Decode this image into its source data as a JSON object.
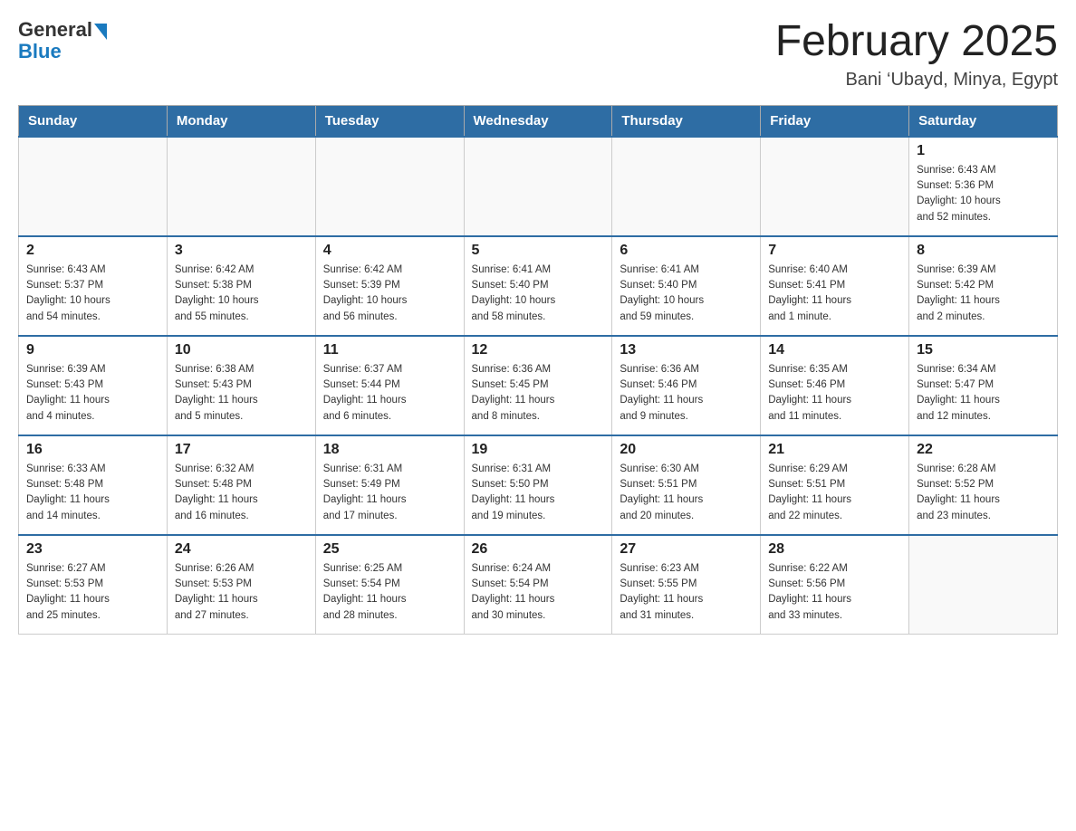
{
  "header": {
    "logo_general": "General",
    "logo_blue": "Blue",
    "month_title": "February 2025",
    "location": "Bani ‘Ubayd, Minya, Egypt"
  },
  "weekdays": [
    "Sunday",
    "Monday",
    "Tuesday",
    "Wednesday",
    "Thursday",
    "Friday",
    "Saturday"
  ],
  "weeks": [
    [
      {
        "day": "",
        "info": ""
      },
      {
        "day": "",
        "info": ""
      },
      {
        "day": "",
        "info": ""
      },
      {
        "day": "",
        "info": ""
      },
      {
        "day": "",
        "info": ""
      },
      {
        "day": "",
        "info": ""
      },
      {
        "day": "1",
        "info": "Sunrise: 6:43 AM\nSunset: 5:36 PM\nDaylight: 10 hours\nand 52 minutes."
      }
    ],
    [
      {
        "day": "2",
        "info": "Sunrise: 6:43 AM\nSunset: 5:37 PM\nDaylight: 10 hours\nand 54 minutes."
      },
      {
        "day": "3",
        "info": "Sunrise: 6:42 AM\nSunset: 5:38 PM\nDaylight: 10 hours\nand 55 minutes."
      },
      {
        "day": "4",
        "info": "Sunrise: 6:42 AM\nSunset: 5:39 PM\nDaylight: 10 hours\nand 56 minutes."
      },
      {
        "day": "5",
        "info": "Sunrise: 6:41 AM\nSunset: 5:40 PM\nDaylight: 10 hours\nand 58 minutes."
      },
      {
        "day": "6",
        "info": "Sunrise: 6:41 AM\nSunset: 5:40 PM\nDaylight: 10 hours\nand 59 minutes."
      },
      {
        "day": "7",
        "info": "Sunrise: 6:40 AM\nSunset: 5:41 PM\nDaylight: 11 hours\nand 1 minute."
      },
      {
        "day": "8",
        "info": "Sunrise: 6:39 AM\nSunset: 5:42 PM\nDaylight: 11 hours\nand 2 minutes."
      }
    ],
    [
      {
        "day": "9",
        "info": "Sunrise: 6:39 AM\nSunset: 5:43 PM\nDaylight: 11 hours\nand 4 minutes."
      },
      {
        "day": "10",
        "info": "Sunrise: 6:38 AM\nSunset: 5:43 PM\nDaylight: 11 hours\nand 5 minutes."
      },
      {
        "day": "11",
        "info": "Sunrise: 6:37 AM\nSunset: 5:44 PM\nDaylight: 11 hours\nand 6 minutes."
      },
      {
        "day": "12",
        "info": "Sunrise: 6:36 AM\nSunset: 5:45 PM\nDaylight: 11 hours\nand 8 minutes."
      },
      {
        "day": "13",
        "info": "Sunrise: 6:36 AM\nSunset: 5:46 PM\nDaylight: 11 hours\nand 9 minutes."
      },
      {
        "day": "14",
        "info": "Sunrise: 6:35 AM\nSunset: 5:46 PM\nDaylight: 11 hours\nand 11 minutes."
      },
      {
        "day": "15",
        "info": "Sunrise: 6:34 AM\nSunset: 5:47 PM\nDaylight: 11 hours\nand 12 minutes."
      }
    ],
    [
      {
        "day": "16",
        "info": "Sunrise: 6:33 AM\nSunset: 5:48 PM\nDaylight: 11 hours\nand 14 minutes."
      },
      {
        "day": "17",
        "info": "Sunrise: 6:32 AM\nSunset: 5:48 PM\nDaylight: 11 hours\nand 16 minutes."
      },
      {
        "day": "18",
        "info": "Sunrise: 6:31 AM\nSunset: 5:49 PM\nDaylight: 11 hours\nand 17 minutes."
      },
      {
        "day": "19",
        "info": "Sunrise: 6:31 AM\nSunset: 5:50 PM\nDaylight: 11 hours\nand 19 minutes."
      },
      {
        "day": "20",
        "info": "Sunrise: 6:30 AM\nSunset: 5:51 PM\nDaylight: 11 hours\nand 20 minutes."
      },
      {
        "day": "21",
        "info": "Sunrise: 6:29 AM\nSunset: 5:51 PM\nDaylight: 11 hours\nand 22 minutes."
      },
      {
        "day": "22",
        "info": "Sunrise: 6:28 AM\nSunset: 5:52 PM\nDaylight: 11 hours\nand 23 minutes."
      }
    ],
    [
      {
        "day": "23",
        "info": "Sunrise: 6:27 AM\nSunset: 5:53 PM\nDaylight: 11 hours\nand 25 minutes."
      },
      {
        "day": "24",
        "info": "Sunrise: 6:26 AM\nSunset: 5:53 PM\nDaylight: 11 hours\nand 27 minutes."
      },
      {
        "day": "25",
        "info": "Sunrise: 6:25 AM\nSunset: 5:54 PM\nDaylight: 11 hours\nand 28 minutes."
      },
      {
        "day": "26",
        "info": "Sunrise: 6:24 AM\nSunset: 5:54 PM\nDaylight: 11 hours\nand 30 minutes."
      },
      {
        "day": "27",
        "info": "Sunrise: 6:23 AM\nSunset: 5:55 PM\nDaylight: 11 hours\nand 31 minutes."
      },
      {
        "day": "28",
        "info": "Sunrise: 6:22 AM\nSunset: 5:56 PM\nDaylight: 11 hours\nand 33 minutes."
      },
      {
        "day": "",
        "info": ""
      }
    ]
  ]
}
